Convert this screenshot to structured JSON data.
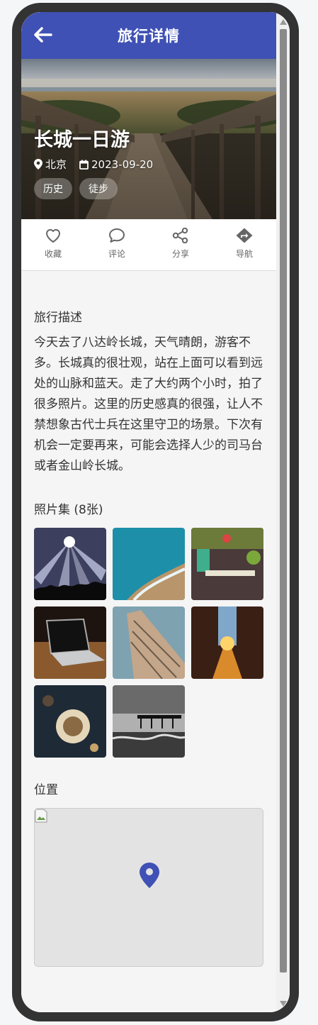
{
  "header": {
    "title": "旅行详情"
  },
  "trip": {
    "title": "长城一日游",
    "location": "北京",
    "date": "2023-09-20",
    "tags": [
      "历史",
      "徒步"
    ]
  },
  "actions": [
    {
      "icon": "heart-icon",
      "label": "收藏"
    },
    {
      "icon": "comment-icon",
      "label": "评论"
    },
    {
      "icon": "share-icon",
      "label": "分享"
    },
    {
      "icon": "directions-icon",
      "label": "导航"
    }
  ],
  "description": {
    "title": "旅行描述",
    "text": "今天去了八达岭长城，天气晴朗，游客不多。长城真的很壮观，站在上面可以看到远处的山脉和蓝天。走了大约两个小时，拍了很多照片。这里的历史感真的很强，让人不禁想象古代士兵在这里守卫的场景。下次有机会一定要再来，可能会选择人少的司马台或者金山岭长城。"
  },
  "gallery": {
    "title": "照片集 (8张)",
    "photos": [
      "concert",
      "coastline",
      "cafe",
      "laptop",
      "building",
      "street-sunset",
      "food",
      "pier"
    ]
  },
  "location_section": {
    "title": "位置"
  },
  "colors": {
    "primary": "#3f51b5",
    "pin": "#3f51b5"
  }
}
